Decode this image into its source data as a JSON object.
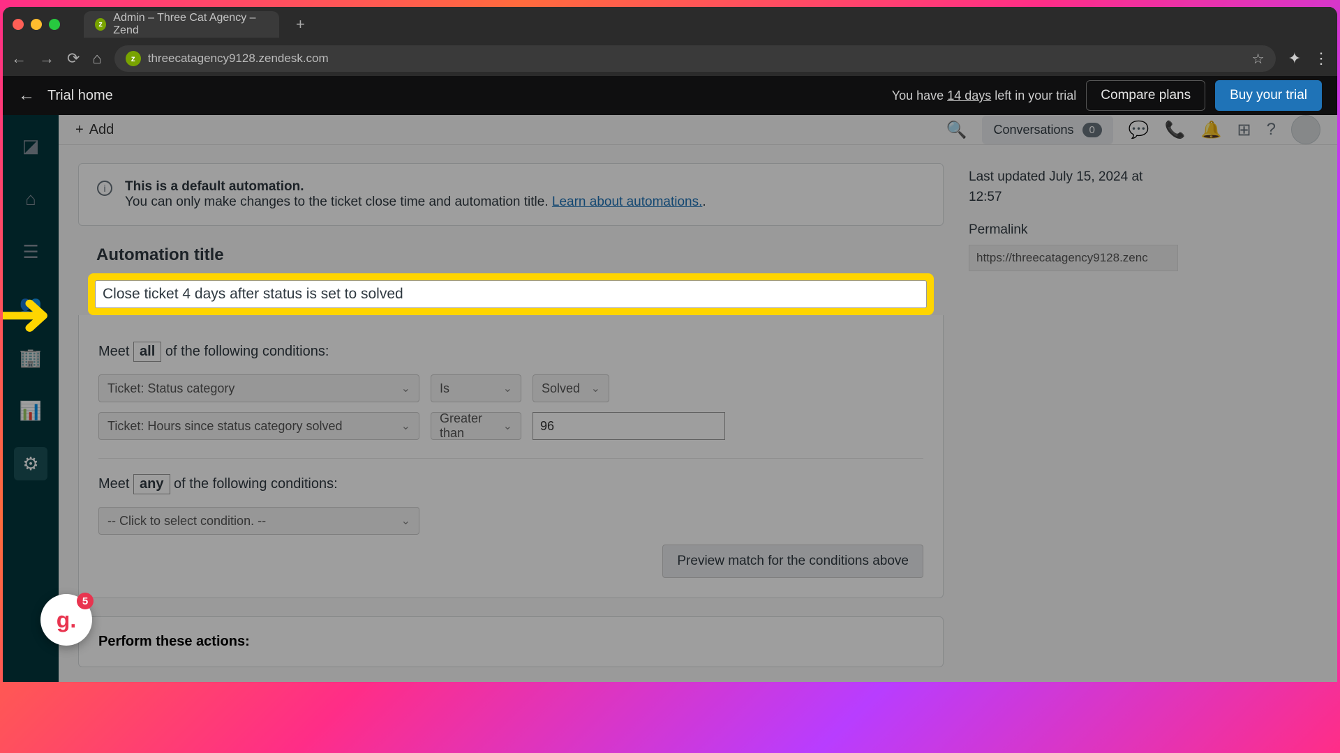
{
  "browser": {
    "tab_title": "Admin – Three Cat Agency – Zend",
    "url": "threecatagency9128.zendesk.com"
  },
  "trial_bar": {
    "back_label": "Trial home",
    "message_prefix": "You have ",
    "days": "14 days",
    "message_suffix": " left in your trial",
    "compare": "Compare plans",
    "buy": "Buy your trial"
  },
  "toolbar": {
    "add": "Add",
    "conversations": "Conversations",
    "conv_count": "0"
  },
  "info": {
    "line1": "This is a default automation.",
    "line2_a": "You can only make changes to the ticket close time and automation title. ",
    "link": "Learn about automations.",
    "line2_b": "."
  },
  "title_section": {
    "heading": "Automation title",
    "value": "Close ticket 4 days after status is set to solved"
  },
  "conditions": {
    "meet_prefix": "Meet ",
    "all": "all",
    "any": "any",
    "meet_suffix": " of the following conditions:",
    "row1_field": "Ticket: Status category",
    "row1_op": "Is",
    "row1_val": "Solved",
    "row2_field": "Ticket: Hours since status category solved",
    "row2_op": "Greater than",
    "row2_val": "96",
    "placeholder": "-- Click to select condition. --",
    "preview": "Preview match for the conditions above"
  },
  "actions": {
    "heading": "Perform these actions:"
  },
  "sidebar": {
    "updated": "Last updated July 15, 2024 at 12:57",
    "permalink_label": "Permalink",
    "permalink_url": "https://threecatagency9128.zenc"
  },
  "floating": {
    "count": "5"
  }
}
